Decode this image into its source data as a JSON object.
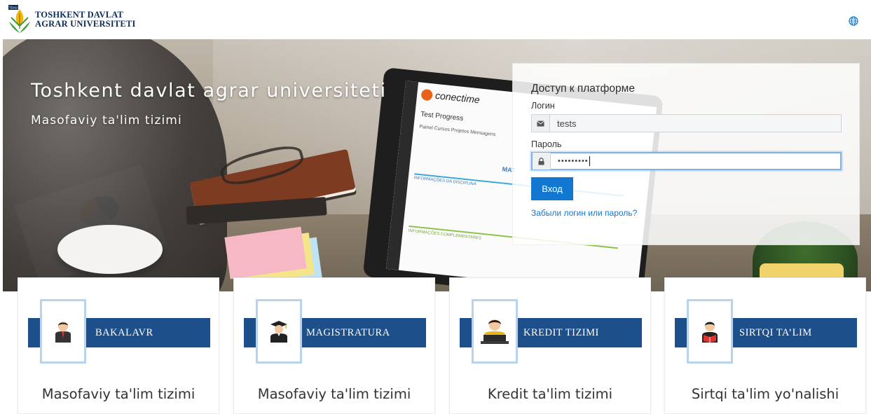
{
  "header": {
    "logo_badge": "TDAU",
    "brand_line1": "TOSHKENT DAVLAT",
    "brand_line2": "AGRAR UNIVERSITETI",
    "language_icon": "globe-icon"
  },
  "hero": {
    "title": "Toshkent davlat agrar universiteti",
    "subtitle": "Masofaviy ta'lim tizimi",
    "laptop": {
      "logo": "conectime",
      "heading": "Test Progress",
      "tabs": "Painel   Cursos   Projetos   Mensagens",
      "label": "MAT",
      "section1": "INFORMAÇÕES DA DISCIPLINA",
      "section2": "INFORMAÇÕES COMPLEMENTARES"
    }
  },
  "login": {
    "title": "Доступ к платформе",
    "username_label": "Логин",
    "username_value": "tests",
    "username_icon": "envelope-icon",
    "password_label": "Пароль",
    "password_value": "•••••••••",
    "password_icon": "lock-icon",
    "submit_label": "Вход",
    "forgot_link": "Забыли логин или пароль?"
  },
  "cards": [
    {
      "label": "BAKALAVR",
      "icon": "student-icon",
      "caption": "Masofaviy ta'lim tizimi"
    },
    {
      "label": "MAGISTRATURA",
      "icon": "graduate-icon",
      "caption": "Masofaviy ta'lim tizimi"
    },
    {
      "label": "KREDIT TIZIMI",
      "icon": "laptop-user-icon",
      "caption": "Kredit ta'lim tizimi"
    },
    {
      "label": "SIRTQI TA’LIM",
      "icon": "reader-icon",
      "caption": "Sirtqi ta'lim yo'nalishi"
    }
  ],
  "colors": {
    "brand_navy": "#1d4f8b",
    "link_blue": "#1177d1",
    "frame_blue": "#b8d3ee"
  }
}
